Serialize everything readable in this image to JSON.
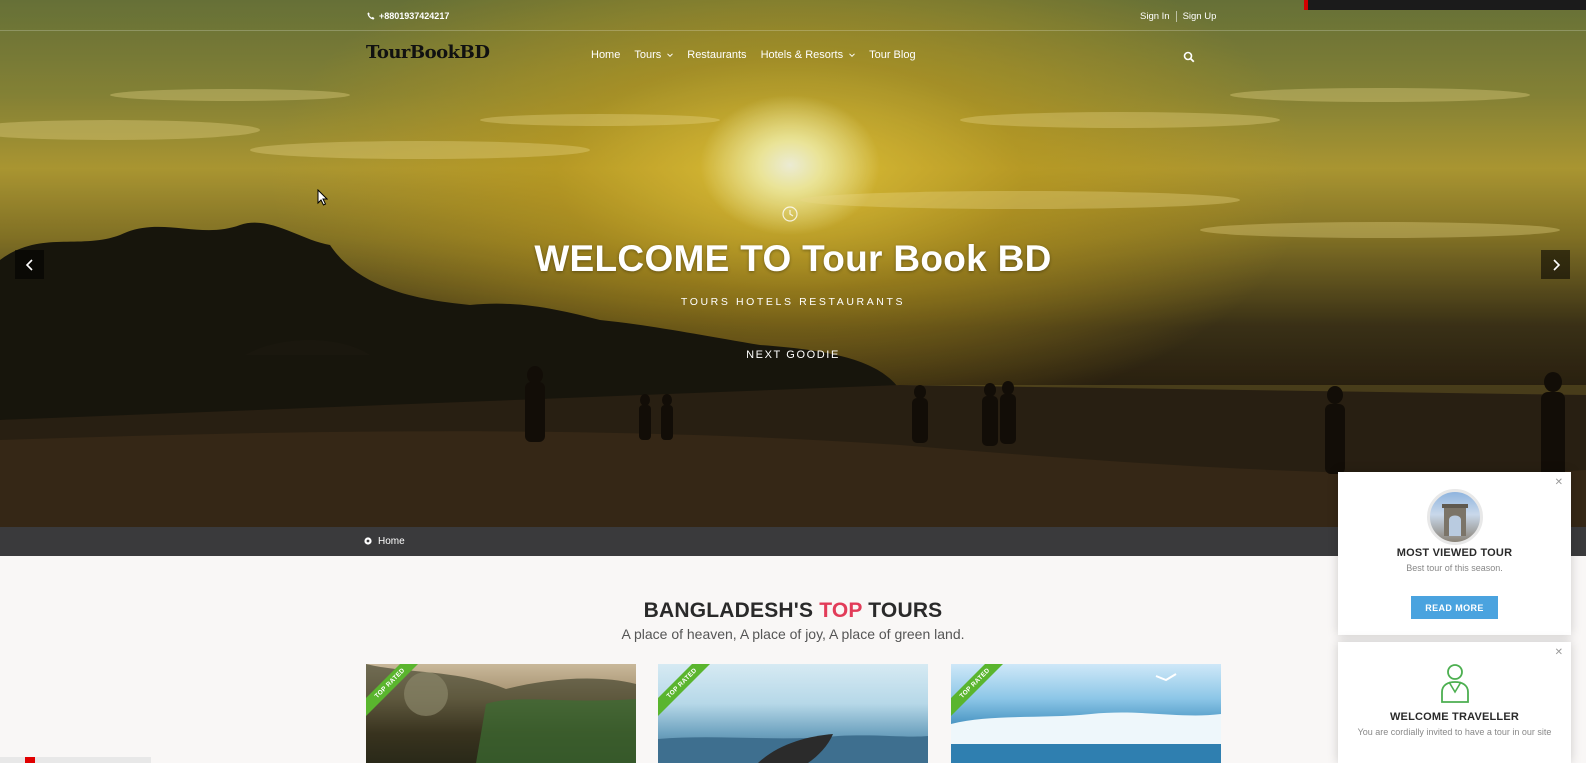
{
  "topbar": {
    "phone": "+8801937424217",
    "sign_in": "Sign In",
    "sign_up": "Sign Up"
  },
  "brand": {
    "logo_text": "TourBookBD"
  },
  "nav": {
    "items": [
      {
        "label": "Home"
      },
      {
        "label": "Tours"
      },
      {
        "label": "Restaurants"
      },
      {
        "label": "Hotels & Resorts"
      },
      {
        "label": "Tour Blog"
      }
    ]
  },
  "hero": {
    "title": "WELCOME TO Tour Book BD",
    "subtitle": "TOURS HOTELS RESTAURANTS",
    "button": "NEXT GOODIE"
  },
  "breadcrumb": {
    "home": "Home"
  },
  "section": {
    "title_part1": "BANGLADESH'S ",
    "title_highlight": "TOP",
    "title_part2": " TOURS",
    "subtitle": "A place of heaven, A place of joy, A place of green land."
  },
  "cards": [
    {
      "badge": "TOP RATED"
    },
    {
      "badge": "TOP RATED"
    },
    {
      "badge": "TOP RATED"
    }
  ],
  "widgets": {
    "most_viewed": {
      "title": "MOST VIEWED TOUR",
      "subtitle": "Best tour of this season.",
      "button": "READ MORE"
    },
    "welcome": {
      "title": "WELCOME TRAVELLER",
      "subtitle": "You are cordially invited to have a tour in our site"
    }
  },
  "colors": {
    "accent_red": "#e23c59",
    "button_blue": "#4aa3df",
    "ribbon_green": "#5ab52e",
    "breadcrumb_bg": "#3a3a3c"
  },
  "icons": [
    "phone-icon",
    "chevron-down-icon",
    "search-icon",
    "clock-icon",
    "arrow-left-icon",
    "arrow-right-icon",
    "map-pin-icon",
    "close-icon",
    "traveller-icon",
    "cursor-icon"
  ]
}
